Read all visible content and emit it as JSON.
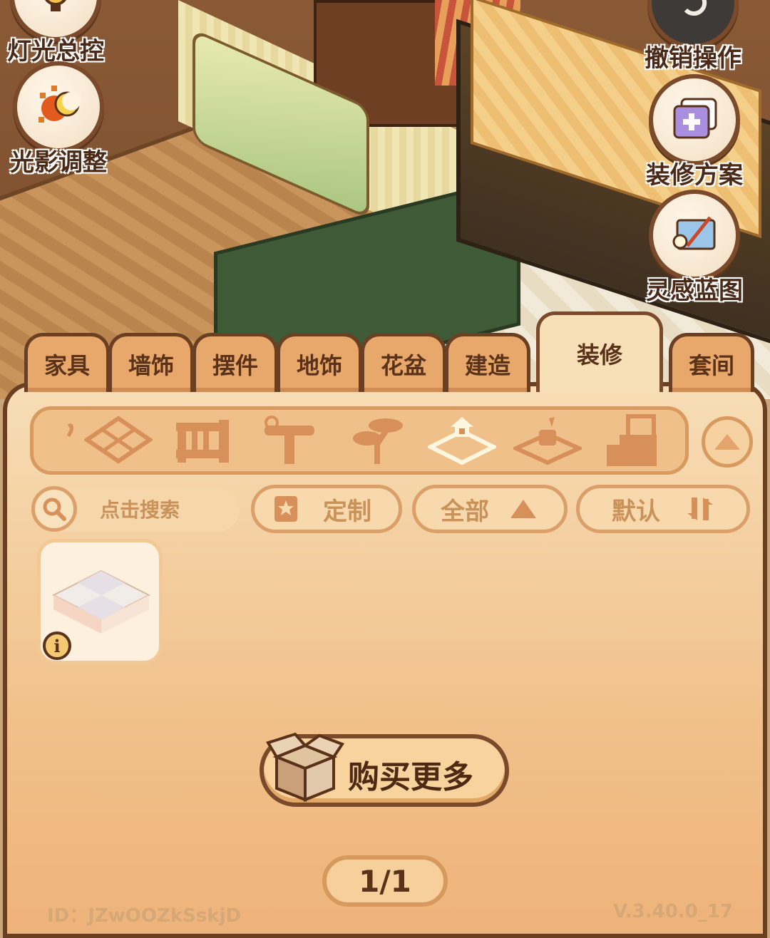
{
  "side_buttons": {
    "lighting_label": "灯光总控",
    "shadow_label": "光影调整",
    "undo_label": "撤销操作",
    "plan_label": "装修方案",
    "blueprint_label": "灵感蓝图"
  },
  "tabs": [
    {
      "label": "家具"
    },
    {
      "label": "墙饰"
    },
    {
      "label": "摆件"
    },
    {
      "label": "地饰"
    },
    {
      "label": "花盆"
    },
    {
      "label": "建造"
    },
    {
      "label": "装修",
      "active": true
    },
    {
      "label": "套间"
    }
  ],
  "categories": [
    "wallpaper-icon",
    "tile-icon",
    "fence-icon",
    "lamp-post-icon",
    "bonsai-icon",
    "floor-tile-icon",
    "plant-mat-icon",
    "stairs-door-icon"
  ],
  "selected_category": "floor-tile-icon",
  "toolbar": {
    "search_placeholder": "点击搜索",
    "custom_label": "定制",
    "filter_label": "全部",
    "sort_label": "默认"
  },
  "buy_more_label": "购买更多",
  "page_indicator": "1/1",
  "footer": {
    "id_text": "ID：JZwOOZkSskjD",
    "version": "V.3.40.0_17"
  },
  "colors": {
    "panel_border": "#6b3f22",
    "tab_bg": "#e8a86c",
    "active_tab_bg": "#f7dfb8",
    "text_dark": "#5a3219"
  }
}
